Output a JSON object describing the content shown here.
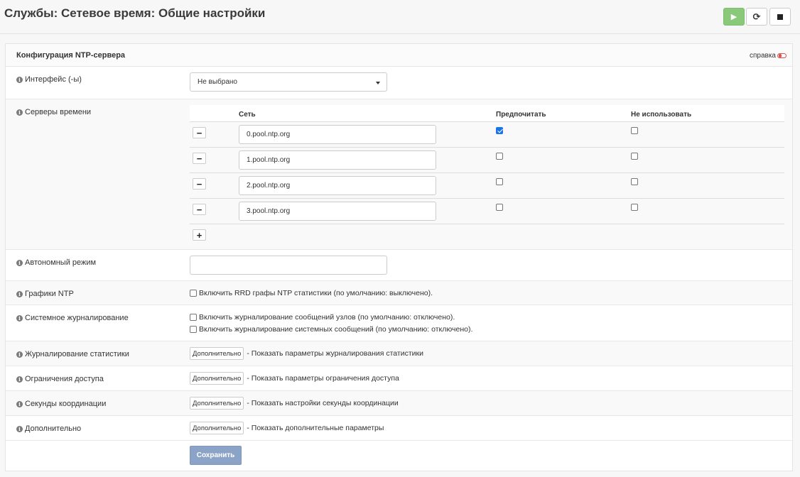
{
  "page": {
    "title": "Службы: Сетевое время: Общие настройки",
    "service_buttons": {
      "start_icon": "play-icon",
      "restart_icon": "refresh-icon",
      "stop_icon": "stop-icon"
    }
  },
  "panel": {
    "title": "Конфигурация NTP-сервера",
    "help_label": "справка",
    "help_icon": "toggle-off-icon",
    "accent_color": "#d9534f"
  },
  "interfaces": {
    "label": "Интерфейс (-ы)",
    "selected": "Не выбрано"
  },
  "servers": {
    "label": "Серверы времени",
    "columns": {
      "network": "Сеть",
      "prefer": "Предпочитать",
      "noselect": "Не использовать"
    },
    "rows": [
      {
        "value": "0.pool.ntp.org",
        "prefer": true,
        "noselect": false
      },
      {
        "value": "1.pool.ntp.org",
        "prefer": false,
        "noselect": false
      },
      {
        "value": "2.pool.ntp.org",
        "prefer": false,
        "noselect": false
      },
      {
        "value": "3.pool.ntp.org",
        "prefer": false,
        "noselect": false
      }
    ],
    "remove_label": "−",
    "add_label": "+"
  },
  "orphan": {
    "label": "Автономный режим",
    "value": ""
  },
  "graphs": {
    "label": "Графики NTP",
    "checkbox": "Включить RRD графы NTP статистики (по умолчанию: выключено).",
    "checked": false
  },
  "syslog": {
    "label": "Системное журналирование",
    "checkbox_peer": "Включить журналирование сообщений узлов (по умолчанию: отключено).",
    "checkbox_system": "Включить журналирование системных сообщений (по умолчанию: отключено).",
    "peer_checked": false,
    "system_checked": false
  },
  "advanced_sections": [
    {
      "label": "Журналирование статистики",
      "button": "Дополнительно",
      "text": "- Показать параметры журналирования статистики"
    },
    {
      "label": "Ограничения доступа",
      "button": "Дополнительно",
      "text": "- Показать параметры ограничения доступа"
    },
    {
      "label": "Секунды координации",
      "button": "Дополнительно",
      "text": "- Показать настройки секунды координации"
    },
    {
      "label": "Дополнительно",
      "button": "Дополнительно",
      "text": "- Показать дополнительные параметры"
    }
  ],
  "save_label": "Сохранить",
  "info_icon": "i"
}
